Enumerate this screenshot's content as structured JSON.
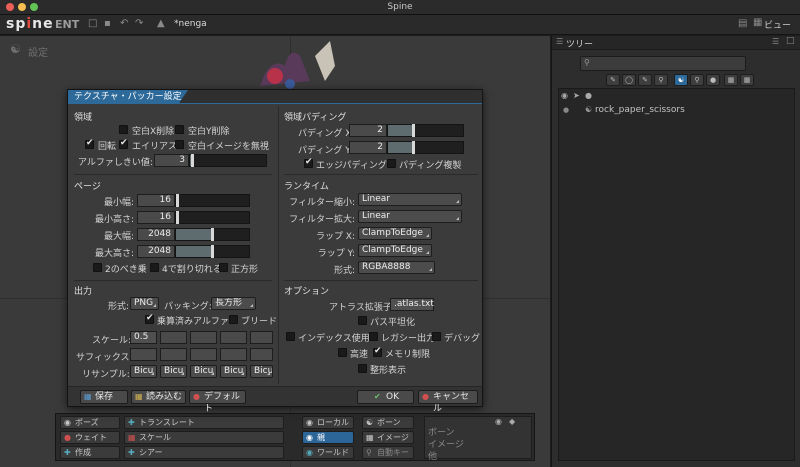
{
  "window": {
    "title": "Spine"
  },
  "app": {
    "logo": "spine",
    "edition": "ENT",
    "project_name": "*nenga",
    "view_button": "ビュー"
  },
  "viewport": {
    "setting_label": "設定"
  },
  "right_panel": {
    "tab": "ツリー",
    "tree_root": "rock_paper_scissors"
  },
  "bottom_toolbar": {
    "pose": "ポーズ",
    "weight": "ウェイト",
    "create": "作成",
    "translate": "トランスレート",
    "scale": "スケール",
    "shear": "シアー",
    "local": "ローカル",
    "parent": "親",
    "world": "ワールド",
    "bone": "ボーン",
    "image": "イメージ",
    "auto_key": "自動キー",
    "bone2": "ボーン",
    "image2": "イメージ",
    "other": "他"
  },
  "dialog": {
    "title": "テクスチャ・パッカー設定",
    "region": {
      "header": "領域",
      "strip_x": "空白X削除",
      "strip_y": "空白Y削除",
      "rotation": "回転",
      "alias": "エイリアス",
      "ignore_blank": "空白イメージを無視",
      "alpha_threshold_label": "アルファしきい値:",
      "alpha_threshold": "3",
      "rotation_checked": true,
      "alias_checked": true
    },
    "padding": {
      "header": "領域パディング",
      "x_label": "パディング X:",
      "x": "2",
      "y_label": "パディング Y:",
      "y": "2",
      "edge_padding": "エッジパディング",
      "duplicate_padding": "パディング複製",
      "edge_checked": true
    },
    "page": {
      "header": "ページ",
      "min_width_label": "最小幅:",
      "min_width": "16",
      "min_height_label": "最小高さ:",
      "min_height": "16",
      "max_width_label": "最大幅:",
      "max_width": "2048",
      "max_height_label": "最大高さ:",
      "max_height": "2048",
      "pot": "2のべき乗",
      "mult4": "4で割り切れる",
      "square": "正方形",
      "min_fill_fraction": 0.02,
      "max_fill_fraction": 0.5
    },
    "runtime": {
      "header": "ランタイム",
      "filter_min_label": "フィルター縮小:",
      "filter_min": "Linear",
      "filter_mag_label": "フィルター拡大:",
      "filter_mag": "Linear",
      "wrap_x_label": "ラップ X:",
      "wrap_x": "ClampToEdge",
      "wrap_y_label": "ラップ Y:",
      "wrap_y": "ClampToEdge",
      "format_label": "形式:",
      "format": "RGBA8888"
    },
    "output": {
      "header": "出力",
      "format_label": "形式:",
      "format": "PNG",
      "packing_label": "パッキング:",
      "packing": "長方形",
      "premultiply": "乗算済みアルファ",
      "bleed": "ブリード",
      "premultiply_checked": true,
      "scale_label": "スケール:",
      "scale": "0.5",
      "suffix_label": "サフィックス:",
      "resample_label": "リサンプル:",
      "resample": [
        "Bicu",
        "Bicu",
        "Bicu",
        "Bicu",
        "Bicu"
      ]
    },
    "options": {
      "header": "オプション",
      "atlas_ext_label": "アトラス拡張子:",
      "atlas_ext": ".atlas.txt",
      "flatten_paths": "パス平坦化",
      "index_use": "インデックス使用",
      "legacy_output": "レガシー出力",
      "debug": "デバッグ",
      "fast": "高速",
      "limit_memory": "メモリ制限",
      "limit_memory_checked": true,
      "pretty_print": "整形表示"
    },
    "buttons": {
      "save": "保存",
      "load": "読み込む",
      "default": "デフォルト",
      "ok": "OK",
      "cancel": "キャンセル"
    }
  }
}
